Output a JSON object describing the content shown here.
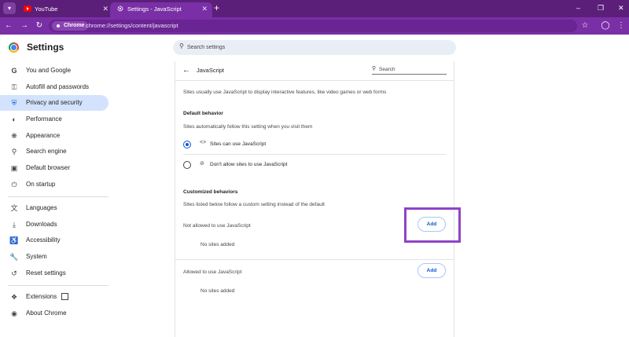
{
  "browser": {
    "tabs": [
      {
        "title": "YouTube",
        "active": false,
        "favicon": "youtube-icon"
      },
      {
        "title": "Settings - JavaScript",
        "active": true,
        "favicon": "settings-gear-icon"
      }
    ],
    "address_chip": "Chrome",
    "url": "chrome://settings/content/javascript",
    "accent_color": "#7a2fa6"
  },
  "settings": {
    "title": "Settings",
    "search_placeholder": "Search settings",
    "nav": [
      {
        "label": "You and Google",
        "icon": "google-g-icon"
      },
      {
        "label": "Autofill and passwords",
        "icon": "key-icon"
      },
      {
        "label": "Privacy and security",
        "icon": "shield-icon",
        "selected": true
      },
      {
        "label": "Performance",
        "icon": "speedometer-icon"
      },
      {
        "label": "Appearance",
        "icon": "palette-icon"
      },
      {
        "label": "Search engine",
        "icon": "search-icon"
      },
      {
        "label": "Default browser",
        "icon": "browser-window-icon"
      },
      {
        "label": "On startup",
        "icon": "power-icon"
      },
      {
        "label": "Languages",
        "icon": "translate-icon"
      },
      {
        "label": "Downloads",
        "icon": "download-icon"
      },
      {
        "label": "Accessibility",
        "icon": "accessibility-icon"
      },
      {
        "label": "System",
        "icon": "wrench-icon"
      },
      {
        "label": "Reset settings",
        "icon": "reset-icon"
      },
      {
        "label": "Extensions",
        "icon": "puzzle-icon"
      },
      {
        "label": "About Chrome",
        "icon": "chrome-logo-icon"
      }
    ]
  },
  "page": {
    "title": "JavaScript",
    "search_placeholder": "Search",
    "intro": "Sites usually use JavaScript to display interactive features, like video games or web forms",
    "default_behavior": {
      "heading": "Default behavior",
      "description": "Sites automatically follow this setting when you visit them",
      "options": [
        {
          "label": "Sites can use JavaScript",
          "icon": "code-brackets-icon",
          "selected": true
        },
        {
          "label": "Don't allow sites to use JavaScript",
          "icon": "code-off-icon",
          "selected": false
        }
      ]
    },
    "customized": {
      "heading": "Customized behaviors",
      "description": "Sites listed below follow a custom setting instead of the default",
      "not_allowed_label": "Not allowed to use JavaScript",
      "not_allowed_empty": "No sites added",
      "allowed_label": "Allowed to use JavaScript",
      "allowed_empty": "No sites added",
      "add_label": "Add"
    }
  },
  "annotation": {
    "highlight_color": "#8e44c7"
  }
}
